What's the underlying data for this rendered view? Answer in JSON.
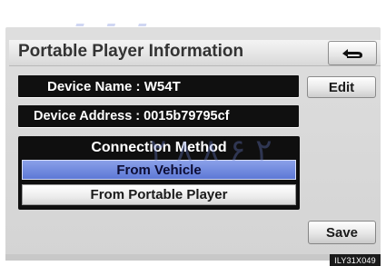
{
  "screen": {
    "title": "Portable Player Information",
    "device_name": "Device Name : W54T",
    "device_address": "Device Address : 0015b79795cf",
    "edit_label": "Edit",
    "connection_method": {
      "title": "Connection Method",
      "options": [
        {
          "label": "From Vehicle",
          "selected": true
        },
        {
          "label": "From Portable Player",
          "selected": false
        }
      ]
    },
    "save_label": "Save",
    "code": "ILY31X049"
  },
  "icons": {
    "back": "back-arrow-icon"
  },
  "colors": {
    "selected_option": "#6c84db",
    "info_bar": "#101010",
    "screen_bg": "#d8d8d8"
  }
}
